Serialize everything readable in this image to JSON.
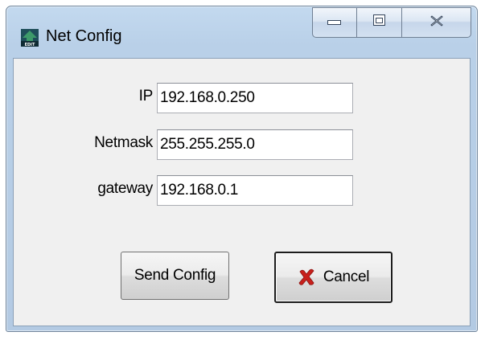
{
  "window": {
    "title": "Net Config",
    "icon": "edit-network-icon"
  },
  "caption_buttons": {
    "minimize": "minimize-icon",
    "maximize": "maximize-icon",
    "close": "close-icon"
  },
  "fields": [
    {
      "label": "IP",
      "value": "192.168.0.250"
    },
    {
      "label": "Netmask",
      "value": "255.255.255.0"
    },
    {
      "label": "gateway",
      "value": "192.168.0.1"
    }
  ],
  "buttons": {
    "send_label": "Send Config",
    "cancel_label": "Cancel",
    "cancel_icon": "red-x-icon"
  },
  "colors": {
    "frame": "#b9d0e8",
    "client": "#f0f0f0",
    "cancel_x": "#c8201c"
  }
}
